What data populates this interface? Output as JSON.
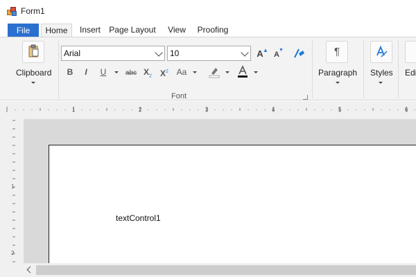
{
  "window": {
    "title": "Form1"
  },
  "tabs": [
    {
      "label": "File"
    },
    {
      "label": "Home"
    },
    {
      "label": "Insert"
    },
    {
      "label": "Page Layout"
    },
    {
      "label": "View"
    },
    {
      "label": "Proofing"
    }
  ],
  "ribbon": {
    "clipboard": {
      "label": "Clipboard"
    },
    "font": {
      "group_label": "Font",
      "font_name": "Arial",
      "font_size": "10",
      "bold": "B",
      "italic": "I",
      "underline": "U",
      "strikethrough": "abc",
      "subscript": "X",
      "subscript_sub": "2",
      "superscript": "X",
      "superscript_sup": "2",
      "change_case": "Aa",
      "grow": "A",
      "shrink": "A"
    },
    "paragraph": {
      "label": "Paragraph"
    },
    "styles": {
      "label": "Styles"
    },
    "editing": {
      "label": "Edi"
    }
  },
  "ruler": {
    "marks": [
      "1",
      "2",
      "3",
      "4",
      "5",
      "6"
    ],
    "v_marks": [
      "1",
      "2"
    ]
  },
  "document": {
    "text": "textControl1"
  },
  "colors": {
    "file_tab": "#2b6fcf",
    "accent_blue": "#1e7ad8",
    "ribbon_bg": "#f3f3f3",
    "workspace": "#d9d9d9"
  }
}
